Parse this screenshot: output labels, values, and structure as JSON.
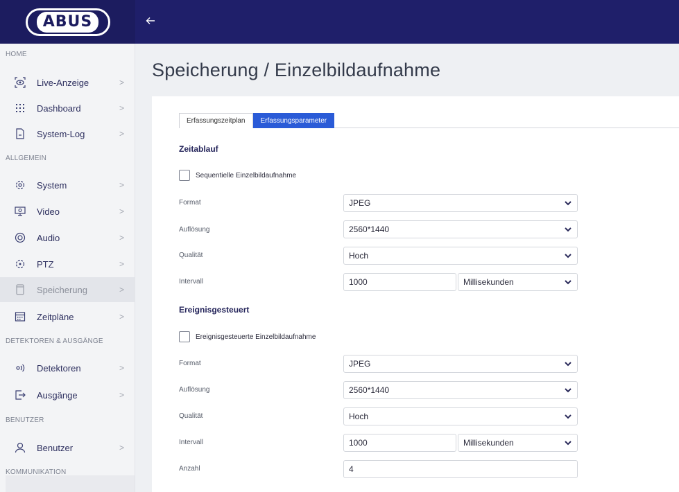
{
  "brand": {
    "logo_text": "ABUS"
  },
  "header": {
    "back_icon": "arrow-left-icon"
  },
  "sidebar": {
    "sections": [
      {
        "title": "HOME"
      },
      {
        "title": "ALLGEMEIN"
      },
      {
        "title": "DETEKTOREN & AUSGÄNGE"
      },
      {
        "title": "BENUTZER"
      },
      {
        "title": "KOMMUNIKATION"
      }
    ],
    "items": [
      {
        "label": "Live-Anzeige",
        "icon": "eye-icon"
      },
      {
        "label": "Dashboard",
        "icon": "dashboard-icon"
      },
      {
        "label": "System-Log",
        "icon": "document-icon"
      },
      {
        "label": "System",
        "icon": "gear-icon"
      },
      {
        "label": "Video",
        "icon": "monitor-icon"
      },
      {
        "label": "Audio",
        "icon": "speaker-icon"
      },
      {
        "label": "PTZ",
        "icon": "ptz-icon"
      },
      {
        "label": "Speicherung",
        "icon": "storage-icon",
        "active": true
      },
      {
        "label": "Zeitpläne",
        "icon": "calendar-icon"
      },
      {
        "label": "Detektoren",
        "icon": "detector-icon"
      },
      {
        "label": "Ausgänge",
        "icon": "output-icon"
      },
      {
        "label": "Benutzer",
        "icon": "user-icon"
      }
    ],
    "chevron": ">"
  },
  "main": {
    "title": "Speicherung / Einzelbildaufnahme",
    "tabs": [
      {
        "label": "Erfassungszeitplan",
        "active": false
      },
      {
        "label": "Erfassungsparameter",
        "active": true
      }
    ],
    "timed": {
      "heading": "Zeitablauf",
      "checkbox_label": "Sequentielle Einzelbildaufnahme",
      "checked": false,
      "format_label": "Format",
      "format_value": "JPEG",
      "resolution_label": "Auflösung",
      "resolution_value": "2560*1440",
      "quality_label": "Qualität",
      "quality_value": "Hoch",
      "interval_label": "Intervall",
      "interval_value": "1000",
      "interval_unit": "Millisekunden"
    },
    "event": {
      "heading": "Ereignisgesteuert",
      "checkbox_label": "Ereignisgesteuerte Einzelbildaufnahme",
      "checked": false,
      "format_label": "Format",
      "format_value": "JPEG",
      "resolution_label": "Auflösung",
      "resolution_value": "2560*1440",
      "quality_label": "Qualität",
      "quality_value": "Hoch",
      "interval_label": "Intervall",
      "interval_value": "1000",
      "interval_unit": "Millisekunden",
      "count_label": "Anzahl",
      "count_value": "4"
    }
  },
  "colors": {
    "header_bg": "#1f1f6a",
    "accent": "#2a5bd7",
    "sidebar_bg": "#f3f4f6"
  }
}
